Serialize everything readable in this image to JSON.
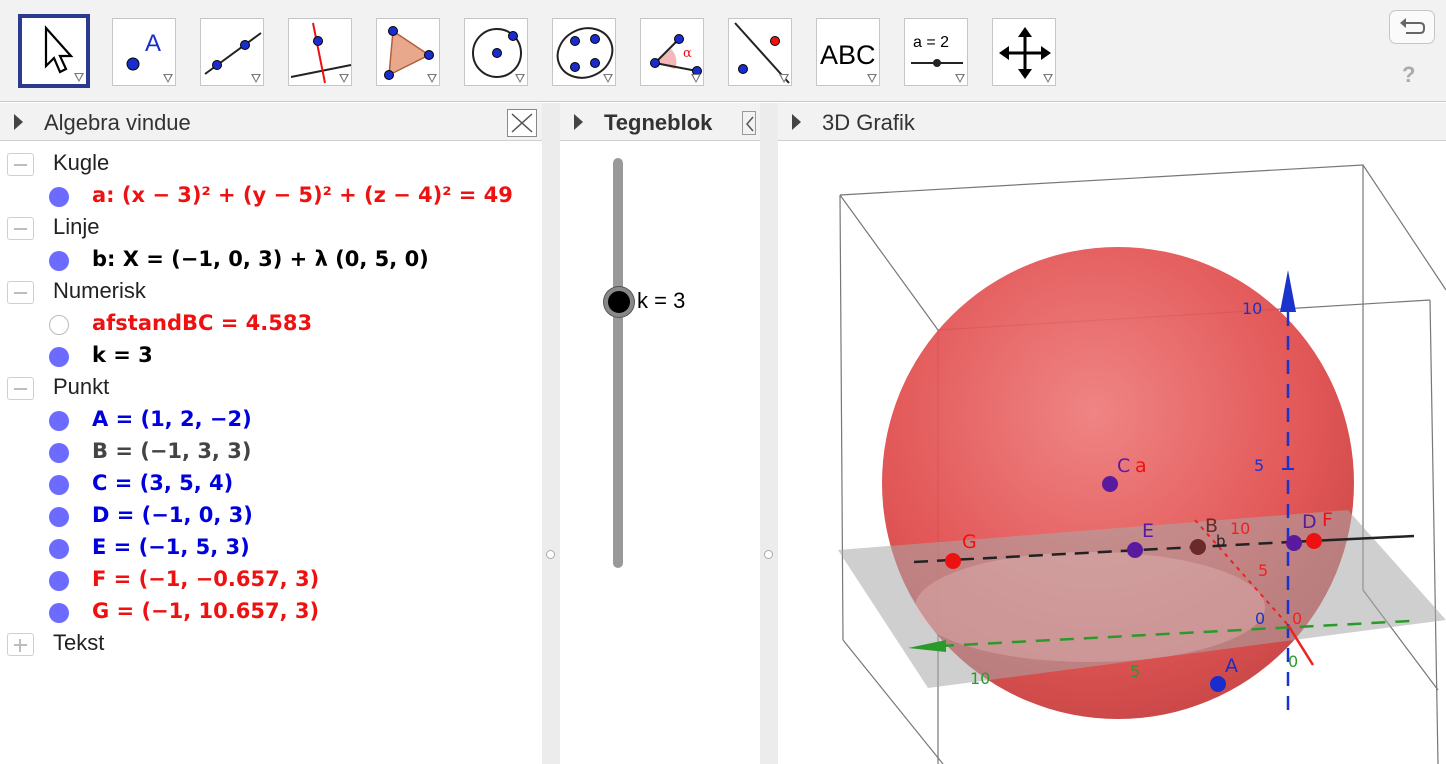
{
  "toolbar": {
    "tools": [
      {
        "name": "move-tool",
        "icon": "arrow-cursor-icon",
        "active": true
      },
      {
        "name": "point-tool",
        "icon": "point-a-icon",
        "label": "A"
      },
      {
        "name": "line-tool",
        "icon": "line-through-points-icon"
      },
      {
        "name": "perpendicular-line-tool",
        "icon": "perpendicular-line-icon"
      },
      {
        "name": "polygon-tool",
        "icon": "polygon-icon"
      },
      {
        "name": "circle-tool",
        "icon": "circle-center-point-icon"
      },
      {
        "name": "conic-tool",
        "icon": "conic-five-points-icon"
      },
      {
        "name": "angle-tool",
        "icon": "angle-icon",
        "label": "α"
      },
      {
        "name": "reflect-tool",
        "icon": "reflect-line-icon"
      },
      {
        "name": "text-tool",
        "icon": "text-icon",
        "label": "ABC"
      },
      {
        "name": "slider-tool",
        "icon": "slider-icon",
        "label": "a = 2"
      },
      {
        "name": "move-view-tool",
        "icon": "move-graphics-view-icon"
      }
    ],
    "undo_icon": "undo-icon",
    "help_label": "?"
  },
  "panels": {
    "algebra_title": "Algebra vindue",
    "tegneblok_title": "Tegneblok",
    "grafik3d_title": "3D Grafik"
  },
  "algebra": {
    "categories": [
      {
        "label": "Kugle",
        "items": [
          {
            "text": "a: (x − 3)² + (y − 5)² + (z − 4)² = 49",
            "color": "#ee1111",
            "visible": true
          }
        ]
      },
      {
        "label": "Linje",
        "items": [
          {
            "text": "b: X = (−1, 0, 3) + λ (0, 5, 0)",
            "color": "#000000",
            "visible": true
          }
        ]
      },
      {
        "label": "Numerisk",
        "items": [
          {
            "text": "afstandBC = 4.583",
            "color": "#ee1111",
            "visible": false
          },
          {
            "text": "k = 3",
            "color": "#000000",
            "visible": true
          }
        ]
      },
      {
        "label": "Punkt",
        "items": [
          {
            "text": "A = (1, 2, −2)",
            "color": "#0000dd",
            "visible": true
          },
          {
            "text": "B = (−1, 3, 3)",
            "color": "#444444",
            "visible": true
          },
          {
            "text": "C = (3, 5, 4)",
            "color": "#0000dd",
            "visible": true
          },
          {
            "text": "D = (−1, 0, 3)",
            "color": "#0000dd",
            "visible": true
          },
          {
            "text": "E = (−1, 5, 3)",
            "color": "#0000dd",
            "visible": true
          },
          {
            "text": "F = (−1, −0.657, 3)",
            "color": "#ee1111",
            "visible": true
          },
          {
            "text": "G = (−1, 10.657, 3)",
            "color": "#ee1111",
            "visible": true
          }
        ]
      },
      {
        "label": "Tekst",
        "collapsed": true,
        "items": []
      }
    ]
  },
  "slider": {
    "label": "k = 3",
    "value": 3
  },
  "graphics3d": {
    "axis_labels": {
      "z_ten": "10",
      "z_five": "5",
      "y_ten": "10",
      "y_five": "5",
      "origin_x": "0",
      "origin_y": "0",
      "x_five": "5",
      "x_ten": "10",
      "origin_z": "0"
    },
    "point_labels": {
      "A": "A",
      "C": "C",
      "sphere": "a",
      "E": "E",
      "B": "B",
      "D": "D",
      "F": "F",
      "G": "G",
      "b": "b"
    },
    "colors": {
      "sphere": "#e84a4a",
      "plane": "#9a9a9a",
      "z_axis": "#1a33cc",
      "y_axis": "#2a9a2a",
      "x_axis": "#ee2222"
    }
  }
}
